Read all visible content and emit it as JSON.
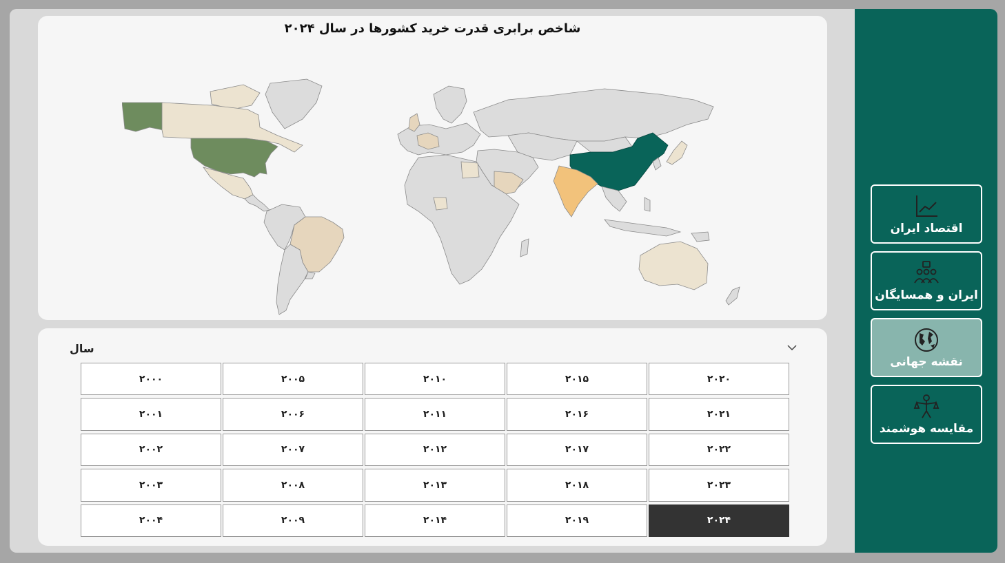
{
  "map": {
    "title": "شاخص برابری قدرت خرید کشورها در سال ۲۰۲۴"
  },
  "slicer": {
    "title": "سال",
    "years": [
      "۲۰۰۰",
      "۲۰۰۱",
      "۲۰۰۲",
      "۲۰۰۳",
      "۲۰۰۴",
      "۲۰۰۵",
      "۲۰۰۶",
      "۲۰۰۷",
      "۲۰۰۸",
      "۲۰۰۹",
      "۲۰۱۰",
      "۲۰۱۱",
      "۲۰۱۲",
      "۲۰۱۳",
      "۲۰۱۴",
      "۲۰۱۵",
      "۲۰۱۶",
      "۲۰۱۷",
      "۲۰۱۸",
      "۲۰۱۹",
      "۲۰۲۰",
      "۲۰۲۱",
      "۲۰۲۲",
      "۲۰۲۳",
      "۲۰۲۴"
    ],
    "selected": "۲۰۲۴"
  },
  "nav": {
    "items": [
      {
        "label": "اقتصاد ایران",
        "icon": "line-chart-icon",
        "active": false
      },
      {
        "label": "ایران و همسایگان",
        "icon": "people-group-icon",
        "active": false
      },
      {
        "label": "نقشه جهانی",
        "icon": "globe-icon",
        "active": true
      },
      {
        "label": "مقایسه هوشمند",
        "icon": "balance-person-icon",
        "active": false
      }
    ]
  },
  "colors": {
    "sidebar": "#096459",
    "active_nav": "#88b5ad",
    "china": "#096459",
    "usa": "#6e8c5e",
    "india": "#f2c27b",
    "tan": "#e6d6bd",
    "light_tan": "#ece3d0",
    "grey": "#dcdcdc",
    "selected_year": "#333333"
  }
}
